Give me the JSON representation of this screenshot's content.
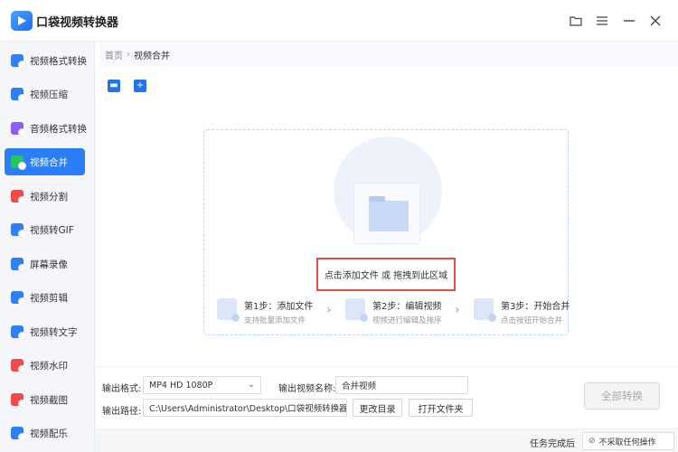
{
  "app": {
    "title": "口袋视频转换器"
  },
  "sidebar": {
    "items": [
      {
        "label": "视频格式转换",
        "color": "#2f7ff6",
        "active": false
      },
      {
        "label": "视频压缩",
        "color": "#2f7ff6",
        "active": false
      },
      {
        "label": "音频格式转换",
        "color": "#8b5cf6",
        "active": false
      },
      {
        "label": "视频合并",
        "color": "#22c55e",
        "active": true
      },
      {
        "label": "视频分割",
        "color": "#f04a4a",
        "active": false
      },
      {
        "label": "视频转GIF",
        "color": "#2f7ff6",
        "active": false
      },
      {
        "label": "屏幕录像",
        "color": "#2f7ff6",
        "active": false
      },
      {
        "label": "视频剪辑",
        "color": "#2f7ff6",
        "active": false
      },
      {
        "label": "视频转文字",
        "color": "#2f7ff6",
        "active": false
      },
      {
        "label": "视频水印",
        "color": "#f04a4a",
        "active": false
      },
      {
        "label": "视频截图",
        "color": "#f04a4a",
        "active": false
      },
      {
        "label": "视频配乐",
        "color": "#2f7ff6",
        "active": false
      }
    ]
  },
  "breadcrumb": {
    "home": "首页",
    "current": "视频合并"
  },
  "dropzone": {
    "hint": "点击添加文件 或 拖拽到此区域",
    "steps": [
      {
        "title": "第1步：添加文件",
        "subtitle": "支持批量添加文件"
      },
      {
        "title": "第2步：编辑视频",
        "subtitle": "视频进行编辑及排序"
      },
      {
        "title": "第3步：开始合并",
        "subtitle": "点击按钮开始合并"
      }
    ]
  },
  "output": {
    "format_label": "输出格式:",
    "format_value": "MP4  HD 1080P",
    "name_label": "输出视频名称:",
    "name_value": "合并视频",
    "path_label": "输出路径:",
    "path_value": "C:\\Users\\Administrator\\Desktop\\口袋视频转换器",
    "change_dir_label": "更改目录",
    "open_folder_label": "打开文件夹",
    "convert_all_label": "全部转换"
  },
  "status": {
    "after_task_label": "任务完成后",
    "after_task_value": "不采取任何操作"
  },
  "colors": {
    "accent": "#2c7ef8",
    "highlight_border": "#e25041"
  }
}
